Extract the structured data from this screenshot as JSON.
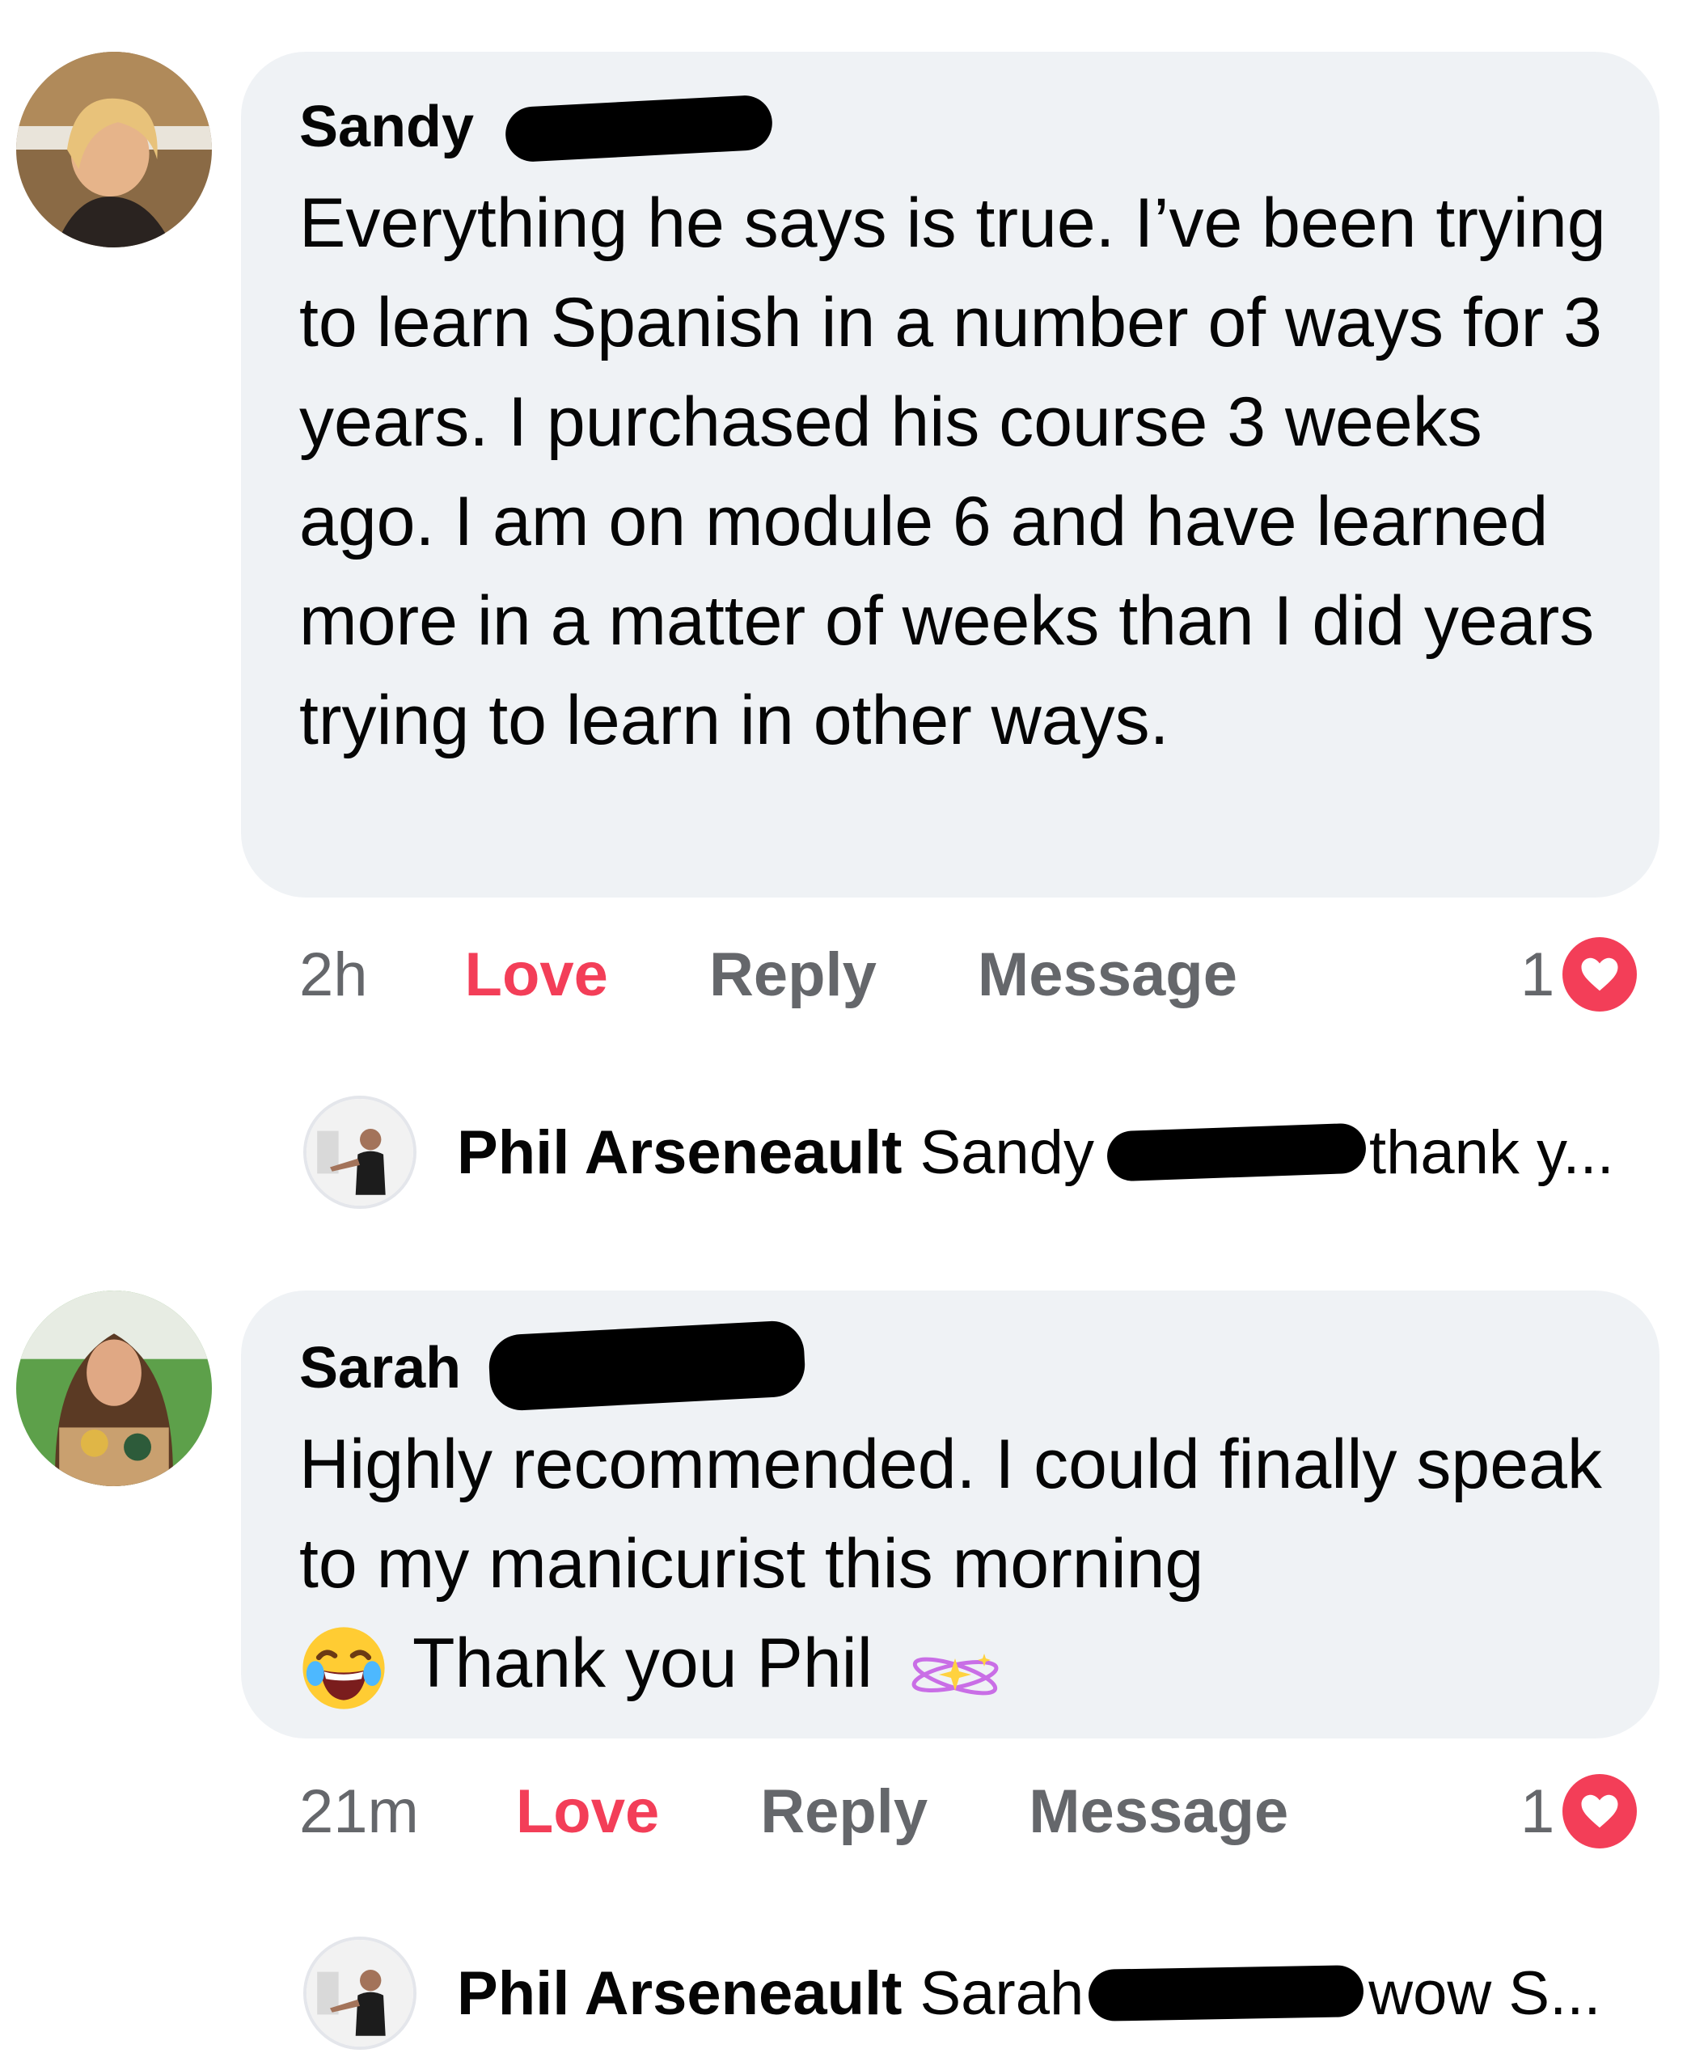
{
  "comments": [
    {
      "author": "Sandy",
      "text": "Everything he says is true. I’ve been trying to learn Spanish in a number of ways for 3 years. I purchased his course 3 weeks ago. I am on module 6 and have learned more in a matter of weeks than I did years trying to learn in other ways.",
      "time": "2h",
      "love_label": "Love",
      "reply_label": "Reply",
      "message_label": "Message",
      "reaction_count": "1",
      "reply_preview": {
        "author": "Phil Arseneault",
        "mention": "Sandy",
        "snippet": "thank y..."
      }
    },
    {
      "author": "Sarah",
      "text_line1": "Highly recommended. I could finally speak to my manicurist this morning",
      "text_line2": "Thank you Phil",
      "time": "21m",
      "love_label": "Love",
      "reply_label": "Reply",
      "message_label": "Message",
      "reaction_count": "1",
      "reply_preview": {
        "author": "Phil Arseneault",
        "mention": "Sarah",
        "snippet": "wow S..."
      }
    }
  ],
  "colors": {
    "bubble": "#eff2f5",
    "love": "#f33e58",
    "secondary": "#65676b",
    "text": "#050505"
  },
  "icons": [
    "heart-icon",
    "laughing-emoji-icon",
    "sparkles-emoji-icon"
  ]
}
